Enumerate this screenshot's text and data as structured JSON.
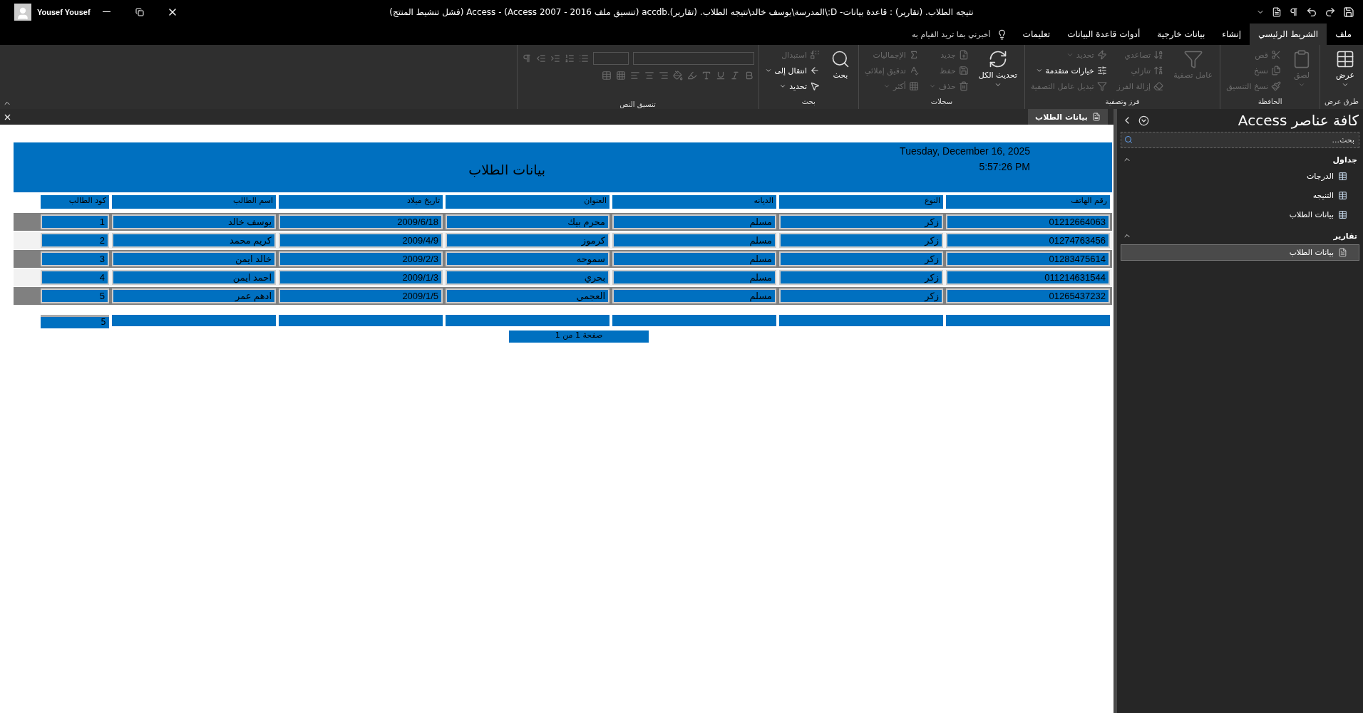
{
  "title_bar": {
    "title": "نتيجه الطلاب. (تقارير) : قاعدة بيانات- D:\\المدرسة\\يوسف خالد\\نتيجه الطلاب. (تقارير).accdb (تنسيق ملف Access 2007 - 2016)  -  Access (فشل تنشيط المنتج)",
    "user": "Yousef Yousef"
  },
  "ribbon_tabs": [
    {
      "label": "ملف",
      "selected": false
    },
    {
      "label": "الشريط الرئيسي",
      "selected": true
    },
    {
      "label": "إنشاء",
      "selected": false
    },
    {
      "label": "بيانات خارجية",
      "selected": false
    },
    {
      "label": "أدوات قاعدة البيانات",
      "selected": false
    },
    {
      "label": "تعليمات",
      "selected": false
    }
  ],
  "tell_me": {
    "placeholder": "أخبرني بما تريد القيام به"
  },
  "ribbon_groups": [
    {
      "label": "طرق عرض",
      "kind": "commands",
      "items": [
        {
          "kind": "large",
          "label": "عرض",
          "disabled": false,
          "dropdown": true
        }
      ]
    },
    {
      "label": "الحافظة",
      "kind": "commands",
      "items": [
        {
          "kind": "large",
          "label": "لصق",
          "disabled": true,
          "dropdown": true
        },
        {
          "kind": "small",
          "label": "قص",
          "disabled": true,
          "dropdown": false
        },
        {
          "kind": "small",
          "label": "نسخ",
          "disabled": true,
          "dropdown": false
        },
        {
          "kind": "small",
          "label": "نسخ التنسيق",
          "disabled": true,
          "dropdown": false
        }
      ]
    },
    {
      "label": "فرز وتصفية",
      "kind": "commands",
      "items": [
        {
          "kind": "large",
          "label": "عامل تصفية",
          "disabled": true,
          "dropdown": false
        },
        {
          "kind": "small",
          "label": "تصاعدي",
          "disabled": true,
          "dropdown": false
        },
        {
          "kind": "small",
          "label": "تنازلي",
          "disabled": true,
          "dropdown": false
        },
        {
          "kind": "small",
          "label": "إزالة الفرز",
          "disabled": true,
          "dropdown": false
        },
        {
          "kind": "small",
          "label": "تحديد",
          "disabled": true,
          "dropdown": true
        },
        {
          "kind": "small",
          "label": "خيارات متقدمة",
          "disabled": false,
          "dropdown": true
        },
        {
          "kind": "small",
          "label": "تبديل عامل التصفية",
          "disabled": true,
          "dropdown": false
        }
      ]
    },
    {
      "label": "سجلات",
      "kind": "commands",
      "items": [
        {
          "kind": "large",
          "label": "تحديث الكل",
          "disabled": false,
          "dropdown": true
        },
        {
          "kind": "small",
          "label": "جديد",
          "disabled": true,
          "dropdown": false
        },
        {
          "kind": "small",
          "label": "حفظ",
          "disabled": true,
          "dropdown": false
        },
        {
          "kind": "small",
          "label": "حذف",
          "disabled": true,
          "dropdown": true
        },
        {
          "kind": "small",
          "label": "الإجماليات",
          "disabled": true,
          "dropdown": false
        },
        {
          "kind": "small",
          "label": "تدقيق إملائي",
          "disabled": true,
          "dropdown": false
        },
        {
          "kind": "small",
          "label": "أكثر",
          "disabled": true,
          "dropdown": true
        }
      ]
    },
    {
      "label": "بحث",
      "kind": "commands",
      "items": [
        {
          "kind": "large",
          "label": "بحث",
          "disabled": false,
          "dropdown": false
        },
        {
          "kind": "small",
          "label": "استبدال",
          "disabled": true,
          "dropdown": false
        },
        {
          "kind": "small",
          "label": "انتقال إلى",
          "disabled": false,
          "dropdown": true
        },
        {
          "kind": "small",
          "label": "تحديد",
          "disabled": false,
          "dropdown": true
        }
      ]
    },
    {
      "label": "تنسيق النص",
      "kind": "format",
      "disabled": true
    }
  ],
  "document_tab": {
    "label": "بيانات الطلاب",
    "selected": true
  },
  "navigation_pane": {
    "title": "كافة عناصر Access",
    "search": {
      "placeholder": "بحث..."
    },
    "groups": [
      {
        "label": "جداول",
        "kind": "table",
        "expanded": true,
        "items": [
          {
            "label": "الدرجات",
            "selected": false
          },
          {
            "label": "التنيجه",
            "selected": false
          },
          {
            "label": "بيانات الطلاب",
            "selected": false
          }
        ]
      },
      {
        "label": "تقارير",
        "kind": "report",
        "expanded": true,
        "items": [
          {
            "label": "بيانات الطلاب",
            "selected": true
          }
        ]
      }
    ]
  },
  "report": {
    "title": "بيانات الطلاب",
    "date": "Tuesday, December 16, 2025",
    "time": "5:57:26 PM",
    "columns": [
      "رقم الهاتف",
      "النوع",
      "الديانه",
      "العنوان",
      "تاريخ ميلاد",
      "اسم الطالب",
      "كود الطالب"
    ],
    "rows": [
      [
        "01212664063",
        "زكر",
        "مسلم",
        "محرم بيك",
        "2009/6/18",
        "يوسف خالد",
        "1"
      ],
      [
        "01274763456",
        "زكر",
        "مسلم",
        "كرموز",
        "2009/4/9",
        "كريم محمد",
        "2"
      ],
      [
        "01283475614",
        "زكر",
        "مسلم",
        "سموحه",
        "2009/2/3",
        "خالد ايمن",
        "3"
      ],
      [
        "011214631544",
        "زكر",
        "مسلم",
        "بحري",
        "2009/1/3",
        "احمد ايمن",
        "4"
      ],
      [
        "01265437232",
        "زكر",
        "مسلم",
        "العجمي",
        "2009/1/5",
        "ادهم عمر",
        "5"
      ]
    ],
    "total_count": "5",
    "page_label": "صفحة 1 من 1"
  }
}
